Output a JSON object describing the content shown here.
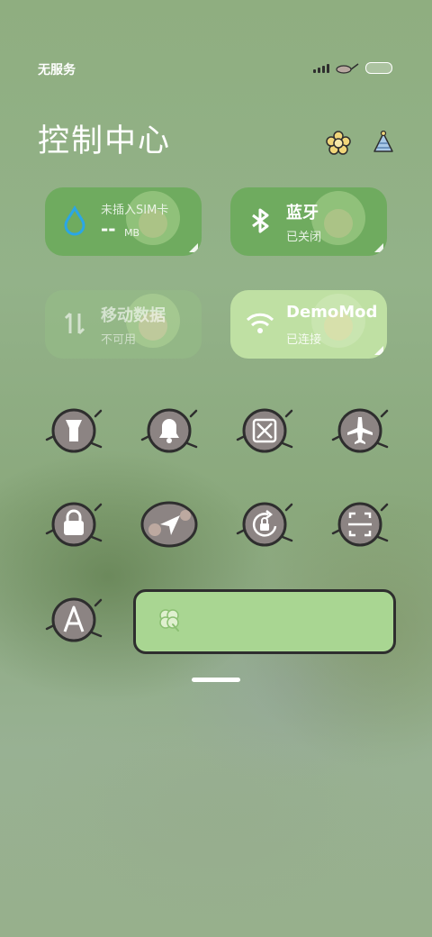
{
  "status_bar": {
    "carrier": "无服务",
    "battery_icon": "battery-icon",
    "signal_icon": "signal-icon"
  },
  "header": {
    "title": "控制中心",
    "settings_icon": "flower-settings-icon",
    "edit_icon": "party-hat-edit-icon"
  },
  "tiles": {
    "data_usage": {
      "title": "未插入SIM卡",
      "value": "--",
      "unit": "MB",
      "icon": "water-drop-icon",
      "accent": "#2aa6e6"
    },
    "bluetooth": {
      "title": "蓝牙",
      "subtitle": "已关闭",
      "icon": "bluetooth-icon"
    },
    "mobile_data": {
      "title": "移动数据",
      "subtitle": "不可用",
      "icon": "mobile-data-icon"
    },
    "wifi": {
      "title": "DemoMod",
      "subtitle": "已连接",
      "icon": "wifi-icon"
    }
  },
  "toggles": [
    {
      "icon": "flashlight-icon"
    },
    {
      "icon": "bell-icon"
    },
    {
      "icon": "screenshot-icon"
    },
    {
      "icon": "airplane-icon"
    },
    {
      "icon": "lock-icon"
    },
    {
      "icon": "location-icon"
    },
    {
      "icon": "rotation-lock-icon"
    },
    {
      "icon": "scan-icon"
    },
    {
      "icon": "font-icon"
    }
  ],
  "brightness": {
    "icon": "clover-icon",
    "level": 1.0,
    "color": "#a9d692"
  },
  "colors": {
    "tile_green": "#6aa85a",
    "tile_light": "#c4e3a8",
    "outline": "#2e2e2e",
    "round_fill": "#8c8483"
  }
}
